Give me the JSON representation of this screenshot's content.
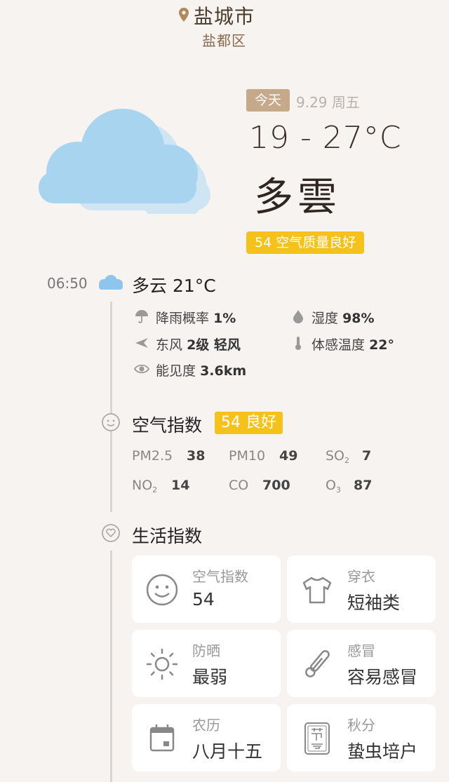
{
  "location": {
    "city": "盐城市",
    "district": "盐都区"
  },
  "today": {
    "badge": "今天",
    "date": "9.29 周五",
    "temp_range": "19 - 27°C",
    "condition": "多雲",
    "aqi": "54 空气质量良好"
  },
  "hourly": {
    "time": "06:50",
    "condition": "多云 21°C"
  },
  "details": {
    "rain_label": "降雨概率",
    "rain_value": "1%",
    "humidity_label": "湿度",
    "humidity_value": "98%",
    "wind_label": "东风",
    "wind_value": "2级 轻风",
    "feel_label": "体感温度",
    "feel_value": "22°",
    "visibility_label": "能见度",
    "visibility_value": "3.6km"
  },
  "air": {
    "title": "空气指数",
    "badge": "54 良好",
    "items": [
      {
        "label": "PM2.5",
        "value": "38"
      },
      {
        "label": "PM10",
        "value": "49"
      },
      {
        "label": "SO",
        "sub": "2",
        "value": "7"
      },
      {
        "label": "NO",
        "sub": "2",
        "value": "14"
      },
      {
        "label": "CO",
        "value": "700"
      },
      {
        "label": "O",
        "sub": "3",
        "value": "87"
      }
    ]
  },
  "life": {
    "title": "生活指数",
    "cards": [
      {
        "title": "空气指数",
        "value": "54",
        "icon": "smile-icon"
      },
      {
        "title": "穿衣",
        "value": "短袖类",
        "icon": "tshirt-icon"
      },
      {
        "title": "防晒",
        "value": "最弱",
        "icon": "sun-icon"
      },
      {
        "title": "感冒",
        "value": "容易感冒",
        "icon": "thermometer-icon"
      },
      {
        "title": "农历",
        "value": "八月十五",
        "icon": "calendar-icon"
      },
      {
        "title": "秋分",
        "value": "蛰虫培户",
        "icon": "solar-term-icon"
      }
    ]
  },
  "colors": {
    "accent": "#c6a98a",
    "aqi": "#f4c21a",
    "cloud": "#a9d4f0"
  }
}
